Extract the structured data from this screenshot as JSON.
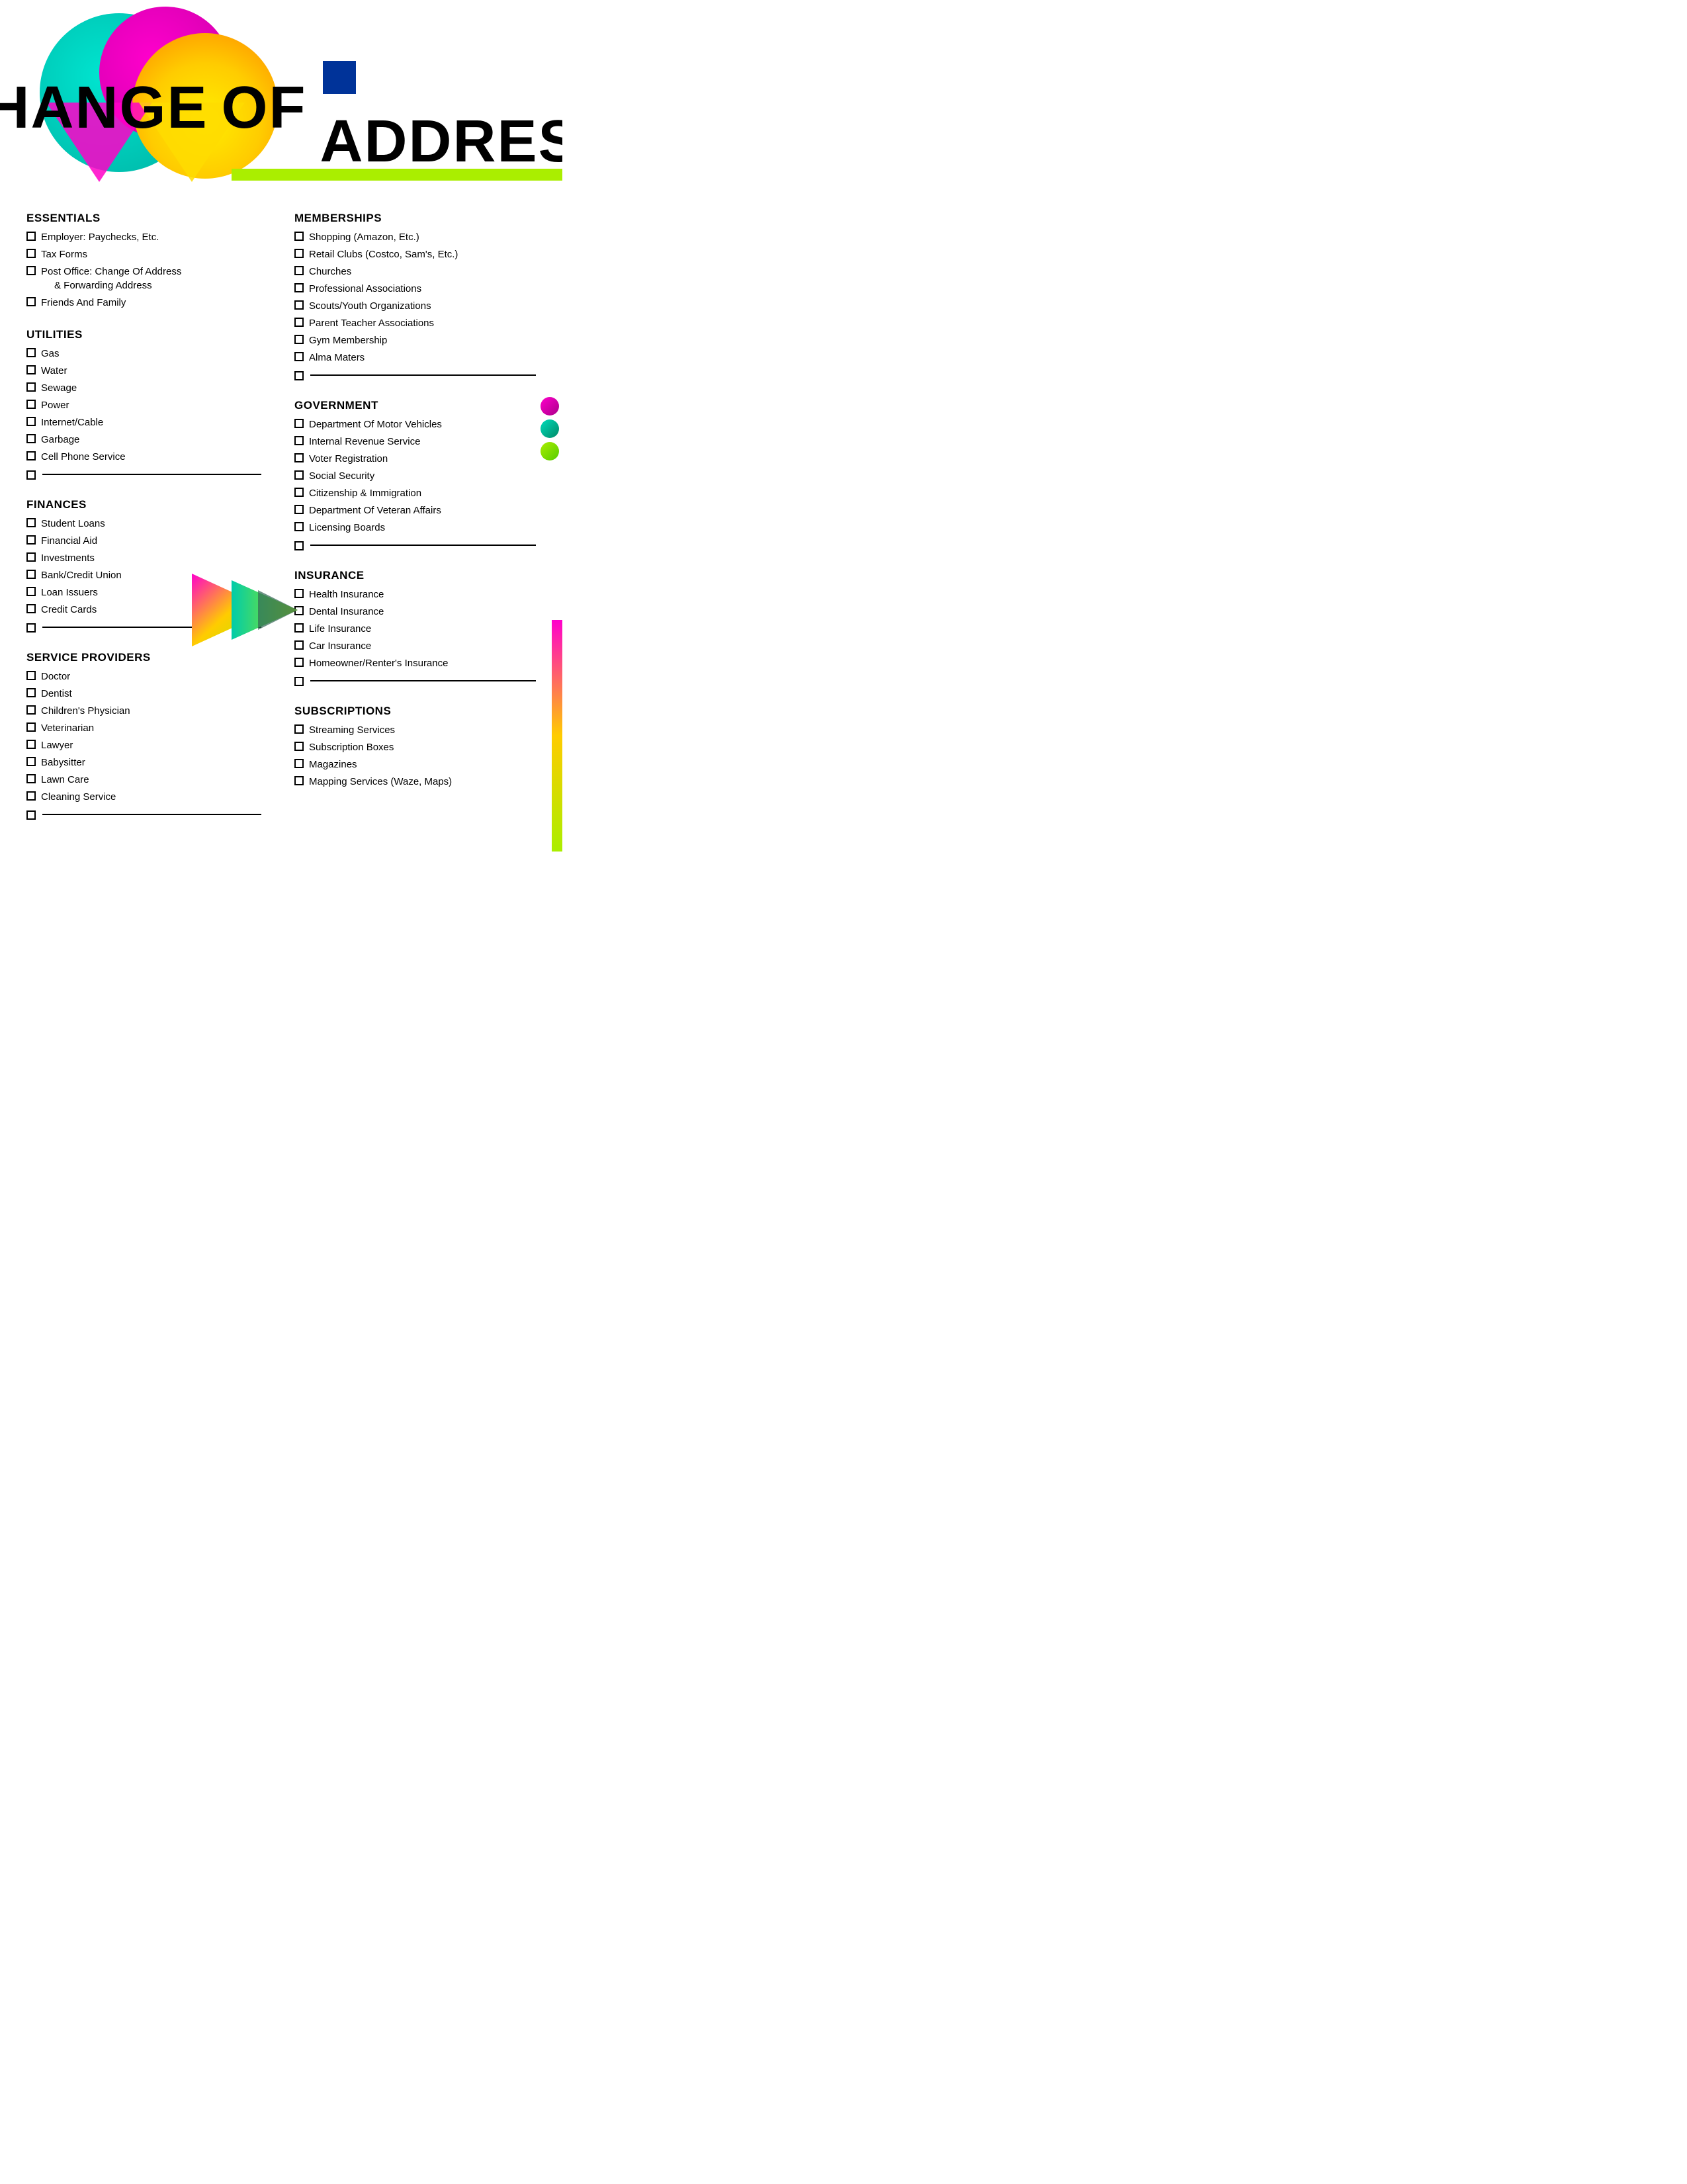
{
  "title": {
    "word1": "CHANGE",
    "word2": "OF",
    "word3": "ADDRESS"
  },
  "sections": {
    "essentials": {
      "title": "ESSENTIALS",
      "items": [
        "Employer: Paychecks, Etc.",
        "Tax Forms",
        "Post Office: Change Of Address\n& Forwarding Address",
        "Friends And Family"
      ]
    },
    "utilities": {
      "title": "UTILITIES",
      "items": [
        "Gas",
        "Water",
        "Sewage",
        "Power",
        "Internet/Cable",
        "Garbage",
        "Cell Phone Service"
      ]
    },
    "finances": {
      "title": "FINANCES",
      "items": [
        "Student Loans",
        "Financial Aid",
        "Investments",
        "Bank/Credit Union",
        "Loan Issuers",
        "Credit Cards"
      ]
    },
    "service_providers": {
      "title": "SERVICE PROVIDERS",
      "items": [
        "Doctor",
        "Dentist",
        "Children's Physician",
        "Veterinarian",
        "Lawyer",
        "Babysitter",
        "Lawn Care",
        "Cleaning Service"
      ]
    },
    "memberships": {
      "title": "MEMBERSHIPS",
      "items": [
        "Shopping (Amazon, Etc.)",
        "Retail Clubs (Costco, Sam's, Etc.)",
        "Churches",
        "Professional Associations",
        "Scouts/Youth Organizations",
        "Parent Teacher Associations",
        "Gym Membership",
        "Alma Maters"
      ]
    },
    "government": {
      "title": "GOVERNMENT",
      "items": [
        "Department Of Motor Vehicles",
        "Internal Revenue Service",
        "Voter Registration",
        "Social Security",
        "Citizenship & Immigration",
        "Department Of Veteran Affairs",
        "Licensing Boards"
      ]
    },
    "insurance": {
      "title": "INSURANCE",
      "items": [
        "Health Insurance",
        "Dental Insurance",
        "Life Insurance",
        "Car Insurance",
        "Homeowner/Renter's Insurance"
      ]
    },
    "subscriptions": {
      "title": "SUBSCRIPTIONS",
      "items": [
        "Streaming Services",
        "Subscription Boxes",
        "Magazines",
        "Mapping Services (Waze, Maps)"
      ]
    }
  }
}
